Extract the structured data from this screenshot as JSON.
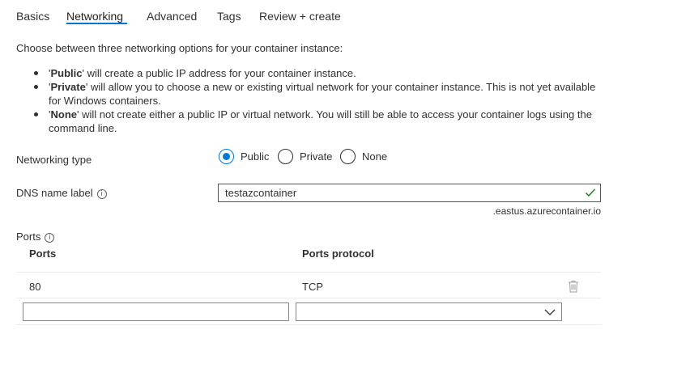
{
  "tabs": [
    {
      "label": "Basics",
      "active": false
    },
    {
      "label": "Networking",
      "active": true
    },
    {
      "label": "Advanced",
      "active": false
    },
    {
      "label": "Tags",
      "active": false
    },
    {
      "label": "Review + create",
      "active": false
    }
  ],
  "intro": "Choose between three networking options for your container instance:",
  "options": [
    {
      "name": "Public",
      "text": " will create a public IP address for your container instance."
    },
    {
      "name": "Private",
      "text": " will allow you to choose a new or existing virtual network for your container instance. This is not yet available for Windows containers."
    },
    {
      "name": "None",
      "text": " will not create either a public IP or virtual network. You will still be able to access your container logs using the command line."
    }
  ],
  "networking_type": {
    "label": "Networking type",
    "options": [
      "Public",
      "Private",
      "None"
    ],
    "selected": "Public"
  },
  "dns": {
    "label": "DNS name label",
    "value": "testazcontainer",
    "suffix": ".eastus.azurecontainer.io",
    "valid": true
  },
  "ports": {
    "label": "Ports",
    "columns": [
      "Ports",
      "Ports protocol"
    ],
    "rows": [
      {
        "port": "80",
        "protocol": "TCP"
      }
    ],
    "new_row": {
      "port": "",
      "protocol": ""
    }
  },
  "colors": {
    "accent": "#0078d4",
    "focus_border": "#8a2da5",
    "valid_check": "#107c10"
  },
  "icons": {
    "info": "info-icon",
    "check": "checkmark-icon",
    "delete": "trash-icon",
    "dropdown": "chevron-down-icon"
  }
}
